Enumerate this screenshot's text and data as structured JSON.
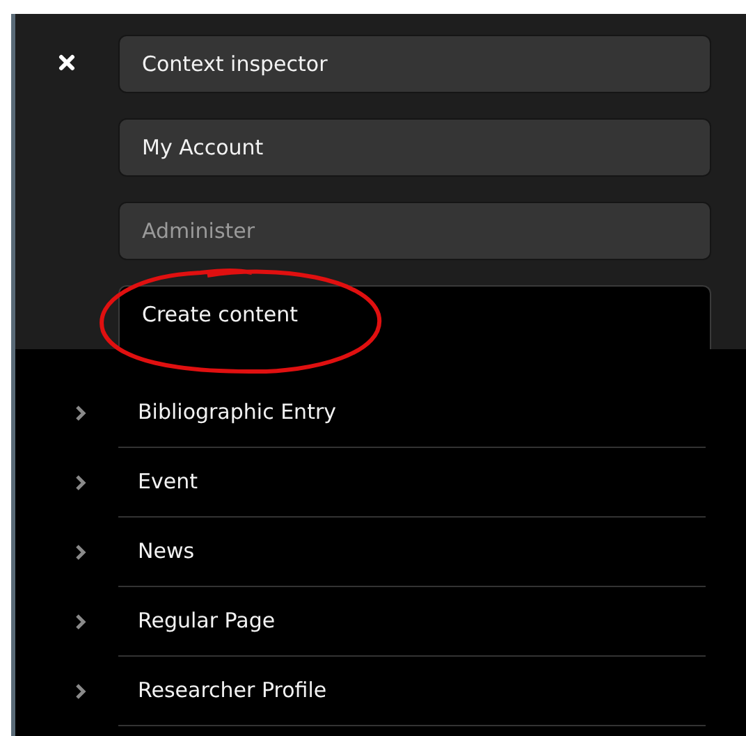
{
  "menu": [
    {
      "label": "Context inspector",
      "selected": false,
      "disabled": false
    },
    {
      "label": "My Account",
      "selected": false,
      "disabled": false
    },
    {
      "label": "Administer",
      "selected": false,
      "disabled": true
    },
    {
      "label": "Create content",
      "selected": true,
      "disabled": false
    }
  ],
  "content_types": [
    {
      "label": "Bibliographic Entry"
    },
    {
      "label": "Event"
    },
    {
      "label": "News"
    },
    {
      "label": "Regular Page"
    },
    {
      "label": "Researcher Profile"
    }
  ]
}
